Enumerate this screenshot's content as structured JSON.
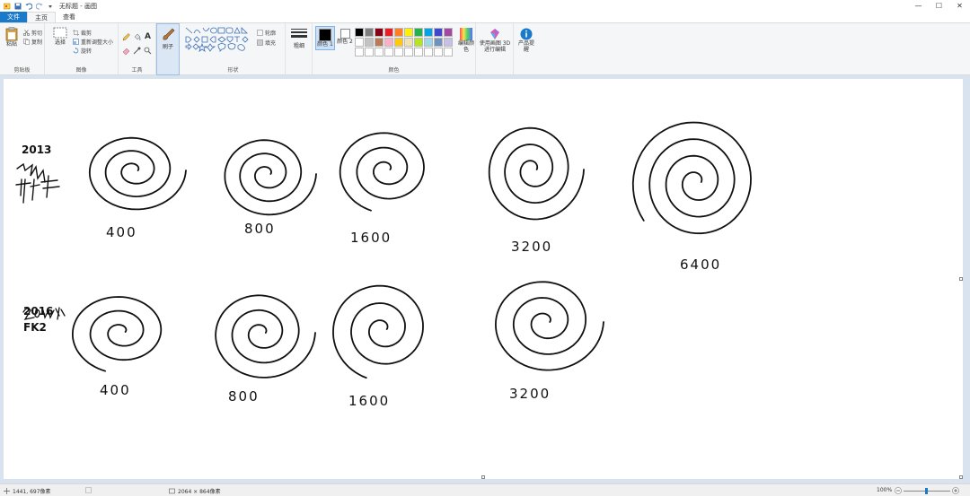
{
  "window": {
    "title": "无标题 - 画图",
    "controls": {
      "minimize": "—",
      "maximize": "☐",
      "close": "✕"
    }
  },
  "tabs": [
    {
      "label": "文件"
    },
    {
      "label": "主页"
    },
    {
      "label": "查看"
    }
  ],
  "ribbon": {
    "clipboard": {
      "paste": "粘贴",
      "cut": "剪切",
      "copy": "复制",
      "group_label": "剪贴板"
    },
    "image": {
      "select": "选择",
      "crop": "裁剪",
      "resize": "重新调整大小",
      "rotate": "旋转",
      "group_label": "图像"
    },
    "tools": {
      "group_label": "工具"
    },
    "brushes": {
      "label": "刷子"
    },
    "shapes": {
      "outline": "轮廓",
      "fill": "填充",
      "group_label": "形状"
    },
    "size": {
      "label": "粗细"
    },
    "colors": {
      "color1": "颜色 1",
      "color2": "颜色 2",
      "edit": "编辑颜色",
      "group_label": "颜色",
      "palette_row1": [
        "#000000",
        "#7f7f7f",
        "#880015",
        "#ed1c24",
        "#ff7f27",
        "#fff200",
        "#22b14c",
        "#00a2e8",
        "#3f48cc",
        "#a349a4"
      ],
      "palette_row2": [
        "#ffffff",
        "#c3c3c3",
        "#b97a57",
        "#ffaec9",
        "#ffc90e",
        "#efe4b0",
        "#b5e61d",
        "#99d9ea",
        "#7092be",
        "#c8bfe7"
      ]
    },
    "paint3d": {
      "label": "使用画图 3D 进行编辑"
    },
    "product": {
      "label": "产品提醒"
    }
  },
  "canvas": {
    "row1_labels": [
      "400",
      "800",
      "1600",
      "3200",
      "6400"
    ],
    "row2_labels": [
      "400",
      "800",
      "1600",
      "3200"
    ],
    "row1_side": [
      "2013"
    ],
    "row2_side": [
      "2016",
      "FK2"
    ]
  },
  "status": {
    "cursor": "1441, 697像素",
    "dimensions": "2064 × 864像素",
    "zoom": "100%"
  }
}
